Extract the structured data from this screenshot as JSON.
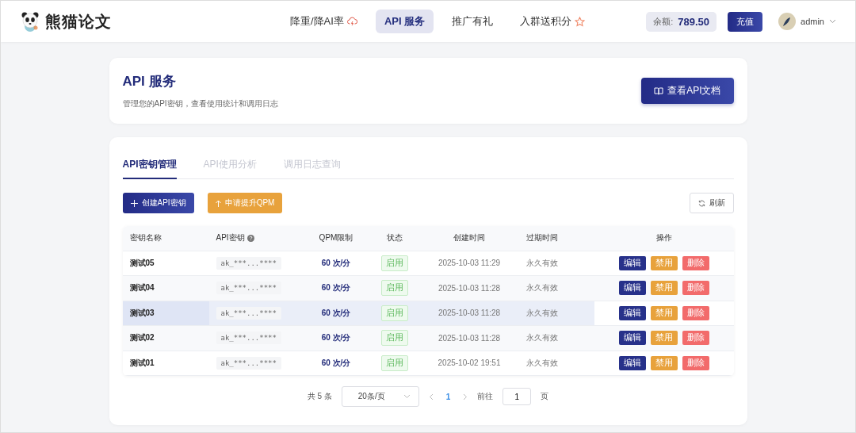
{
  "header": {
    "brand": "熊猫论文",
    "nav": [
      {
        "label": "降重/降AI率",
        "selected": false
      },
      {
        "label": "API 服务",
        "selected": true
      },
      {
        "label": "推广有礼",
        "selected": false
      },
      {
        "label": "入群送积分",
        "selected": false
      }
    ],
    "balance_label": "余额:",
    "balance": "789.50",
    "recharge": "充值",
    "user": "admin"
  },
  "intro": {
    "title": "API 服务",
    "subtitle": "管理您的API密钥，查看使用统计和调用日志",
    "docs_button": "查看API文档"
  },
  "tabs": [
    {
      "label": "API密钥管理",
      "selected": true
    },
    {
      "label": "API使用分析",
      "selected": false
    },
    {
      "label": "调用日志查询",
      "selected": false
    }
  ],
  "toolbar": {
    "create": "创建API密钥",
    "raise_qpm": "申请提升QPM",
    "refresh": "刷新"
  },
  "table": {
    "columns": [
      "密钥名称",
      "API密钥",
      "QPM限制",
      "状态",
      "创建时间",
      "过期时间",
      "操作"
    ],
    "rows": [
      {
        "name": "测试05",
        "key": "ak_***...****",
        "qpm": "60 次/分",
        "status": "启用",
        "created": "2025-10-03 11:29",
        "expires": "永久有效",
        "actions": [
          "编辑",
          "禁用",
          "删除"
        ],
        "hovered": false
      },
      {
        "name": "测试04",
        "key": "ak_***...****",
        "qpm": "60 次/分",
        "status": "启用",
        "created": "2025-10-03 11:28",
        "expires": "永久有效",
        "actions": [
          "编辑",
          "禁用",
          "删除"
        ],
        "hovered": false
      },
      {
        "name": "测试03",
        "key": "ak_***...****",
        "qpm": "60 次/分",
        "status": "启用",
        "created": "2025-10-03 11:28",
        "expires": "永久有效",
        "actions": [
          "编辑",
          "禁用",
          "删除"
        ],
        "hovered": true
      },
      {
        "name": "测试02",
        "key": "ak_***...****",
        "qpm": "60 次/分",
        "status": "启用",
        "created": "2025-10-03 11:28",
        "expires": "永久有效",
        "actions": [
          "编辑",
          "禁用",
          "删除"
        ],
        "hovered": false
      },
      {
        "name": "测试01",
        "key": "ak_***...****",
        "qpm": "60 次/分",
        "status": "启用",
        "created": "2025-10-02 19:51",
        "expires": "永久有效",
        "actions": [
          "编辑",
          "禁用",
          "删除"
        ],
        "hovered": false
      }
    ]
  },
  "pagination": {
    "total": "共 5 条",
    "page_size": "20条/页",
    "pages": [
      {
        "label": "1",
        "selected": true
      }
    ],
    "goto_label": "前往",
    "goto_value": "1",
    "page_unit": "页"
  }
}
